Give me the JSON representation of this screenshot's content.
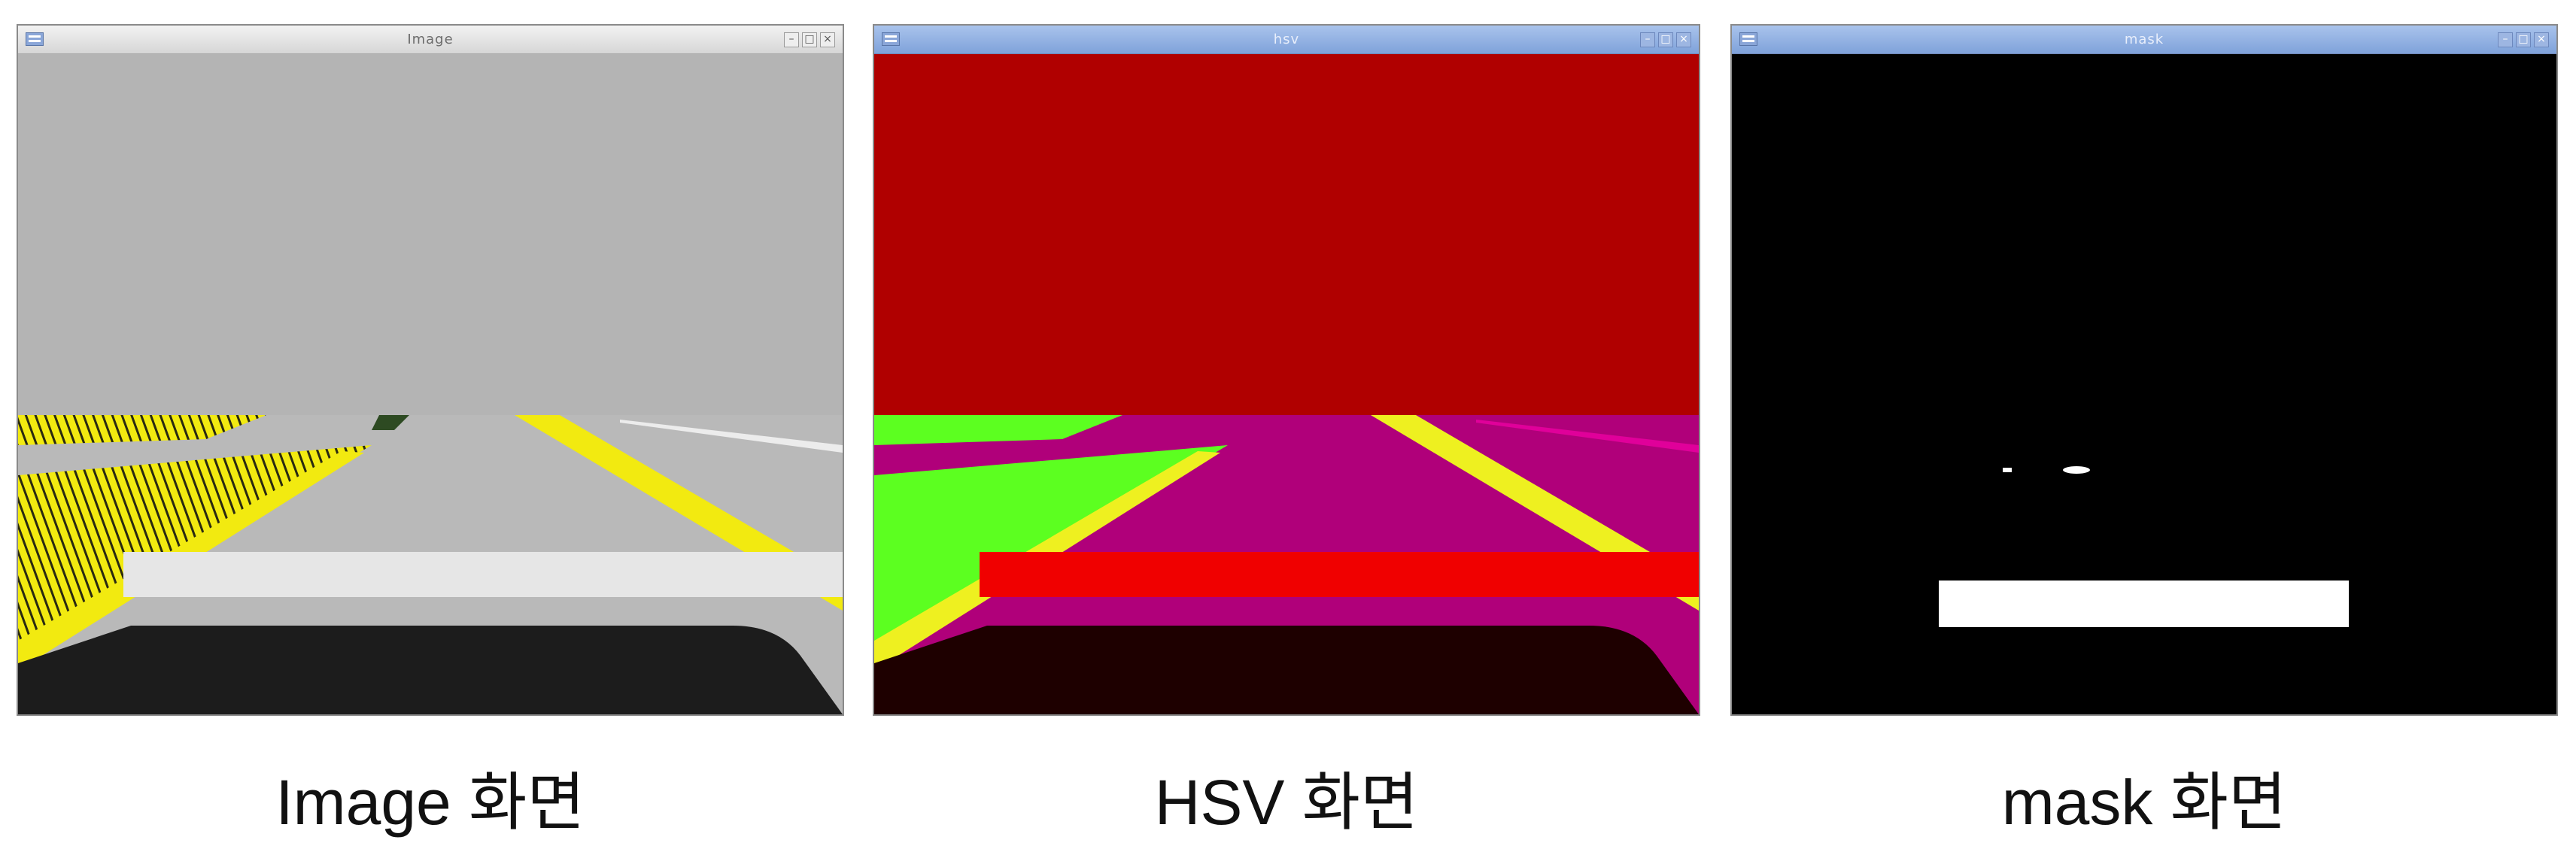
{
  "windows": [
    {
      "id": "image",
      "title": "Image",
      "caption": "Image 화면"
    },
    {
      "id": "hsv",
      "title": "hsv",
      "caption": "HSV 화면"
    },
    {
      "id": "mask",
      "title": "mask",
      "caption": "mask 화면"
    }
  ],
  "icons": {
    "window_menu": "window-menu-icon",
    "minimize": "minimize-icon",
    "maximize": "maximize-icon",
    "close": "close-icon"
  },
  "colors": {
    "image_sky": "#b4b4b4",
    "image_road": "#b9b9b9",
    "image_stripe": "#e6e6e6",
    "image_hood": "#1c1c1c",
    "lane_yellow": "#f2ea10",
    "hsv_sky": "#b00000",
    "hsv_road": "#b0007a",
    "hsv_stripe": "#f00000",
    "hsv_green": "#5cff20",
    "hsv_hood": "#1e0000",
    "mask_bg": "#000000",
    "mask_fg": "#ffffff"
  }
}
